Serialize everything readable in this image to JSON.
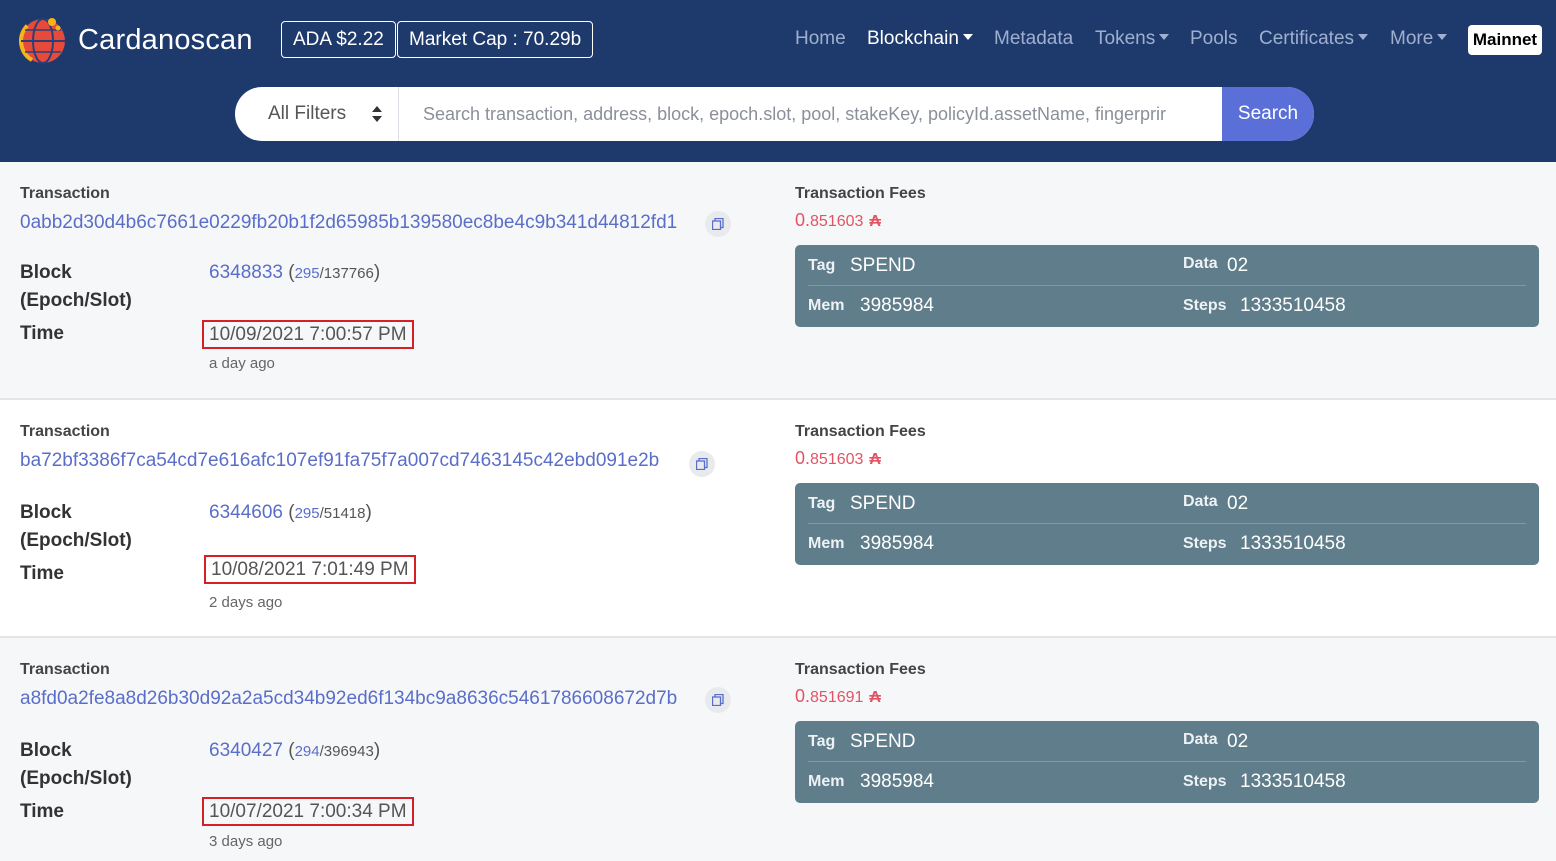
{
  "header": {
    "brand": "Cardanoscan",
    "ada_price": "ADA $2.22",
    "market_cap": "Market Cap : 70.29b",
    "nav": [
      {
        "label": "Home",
        "dropdown": false,
        "active": false
      },
      {
        "label": "Blockchain",
        "dropdown": true,
        "active": true
      },
      {
        "label": "Metadata",
        "dropdown": false,
        "active": false
      },
      {
        "label": "Tokens",
        "dropdown": true,
        "active": false
      },
      {
        "label": "Pools",
        "dropdown": false,
        "active": false
      },
      {
        "label": "Certificates",
        "dropdown": true,
        "active": false
      },
      {
        "label": "More",
        "dropdown": true,
        "active": false
      }
    ],
    "network": "Mainnet"
  },
  "search": {
    "filter": "All Filters",
    "placeholder": "Search transaction, address, block, epoch.slot, pool, stakeKey, policyId.assetName, fingerprir",
    "button": "Search"
  },
  "labels": {
    "transaction": "Transaction",
    "block": "Block",
    "epoch_slot": "(Epoch/Slot)",
    "time": "Time",
    "fees": "Transaction Fees",
    "tag": "Tag",
    "data": "Data",
    "mem": "Mem",
    "steps": "Steps"
  },
  "colors": {
    "header_bg": "#1e3a6d",
    "search_button": "#5b6fd8",
    "link": "#5a6ec9",
    "fee": "#e25464",
    "redeemer_bg": "#5f7d8a",
    "highlight_box": "#d62027"
  },
  "transactions": [
    {
      "hash": "0abb2d30d4b6c7661e0229fb20b1f2d65985b139580ec8be4c9b341d44812fd1",
      "block": "6348833",
      "epoch": "295",
      "slot": "137766",
      "time": "10/09/2021 7:00:57 PM",
      "ago": "a day ago",
      "fee_lead": "0.",
      "fee_rest": "851603",
      "tag": "SPEND",
      "data": "02",
      "mem": "3985984",
      "steps": "1333510458"
    },
    {
      "hash": "ba72bf3386f7ca54cd7e616afc107ef91fa75f7a007cd7463145c42ebd091e2b",
      "block": "6344606",
      "epoch": "295",
      "slot": "51418",
      "time": "10/08/2021 7:01:49 PM",
      "ago": "2 days ago",
      "fee_lead": "0.",
      "fee_rest": "851603",
      "tag": "SPEND",
      "data": "02",
      "mem": "3985984",
      "steps": "1333510458"
    },
    {
      "hash": "a8fd0a2fe8a8d26b30d92a2a5cd34b92ed6f134bc9a8636c5461786608672d7b",
      "block": "6340427",
      "epoch": "294",
      "slot": "396943",
      "time": "10/07/2021 7:00:34 PM",
      "ago": "3 days ago",
      "fee_lead": "0.",
      "fee_rest": "851691",
      "tag": "SPEND",
      "data": "02",
      "mem": "3985984",
      "steps": "1333510458"
    }
  ]
}
